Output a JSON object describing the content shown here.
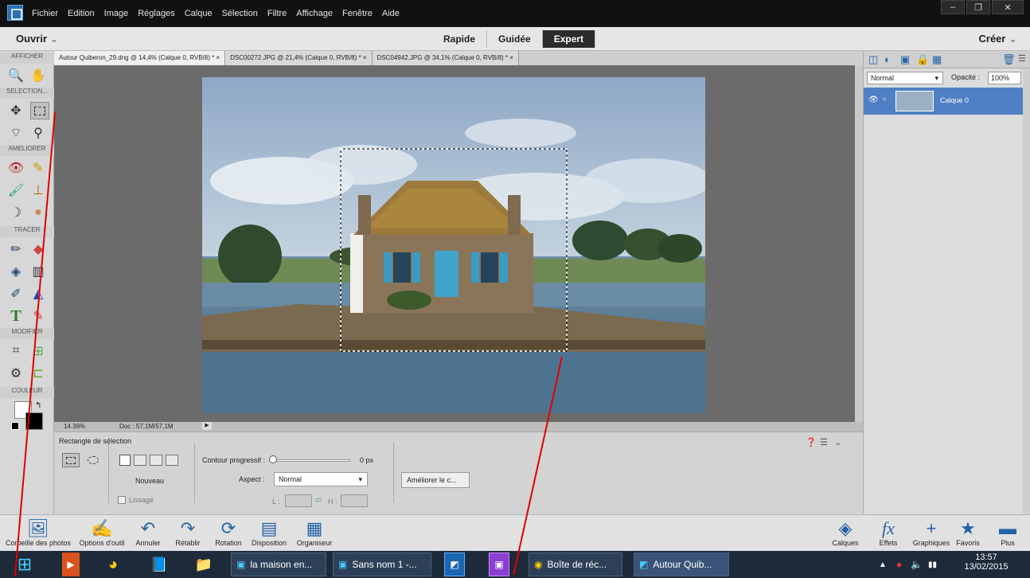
{
  "menubar": {
    "items": [
      "Fichier",
      "Edition",
      "Image",
      "Réglages",
      "Calque",
      "Sélection",
      "Filtre",
      "Affichage",
      "Fenêtre",
      "Aide"
    ]
  },
  "modebar": {
    "open_label": "Ouvrir",
    "modes": [
      "Rapide",
      "Guidée",
      "Expert"
    ],
    "active_mode": "Expert",
    "create_label": "Créer"
  },
  "toolbox": {
    "sections": [
      "AFFICHER",
      "SELECTION...",
      "AMELIORER",
      "TRACER",
      "MODIFIER",
      "COULEUR"
    ]
  },
  "doc_tabs": [
    "Autour Quiberon_29.dng @ 14,4% (Calque 0, RVB/8) *  ×",
    "DSC00272.JPG @ 21,4% (Calque 0, RVB/8) *  ×",
    "DSC04942.JPG @ 34,1% (Calque 0, RVB/8) *  ×"
  ],
  "status": {
    "zoom": "14.36%",
    "doc": "Doc : 57,1M/57,1M"
  },
  "options": {
    "tool_name": "Rectangle de sélection",
    "mode_label": "Nouveau",
    "lissage": "Lissage",
    "contour_label": "Contour progressif :",
    "contour_value": "0 px",
    "aspect_label": "Aspect :",
    "aspect_value": "Normal",
    "l_label": "L :",
    "h_label": "H :",
    "improve_button": "Améliorer le c..."
  },
  "layers_panel": {
    "blend_mode": "Normal",
    "opacity_label": "Opacité :",
    "opacity_value": "100%",
    "layer_name": "Calque 0"
  },
  "bottombar": {
    "left": [
      "Corbeille des photos",
      "Options d'outil",
      "Annuler",
      "Rétablir",
      "Rotation",
      "Disposition",
      "Organiseur"
    ],
    "right": [
      "Calques",
      "Effets",
      "Graphiques",
      "Favoris",
      "Plus"
    ]
  },
  "taskbar": {
    "windows": [
      "la maison en...",
      "Sans nom 1 -...",
      "Boîte de réc...",
      "Autour Quib..."
    ],
    "time": "13:57",
    "date": "13/02/2015"
  }
}
